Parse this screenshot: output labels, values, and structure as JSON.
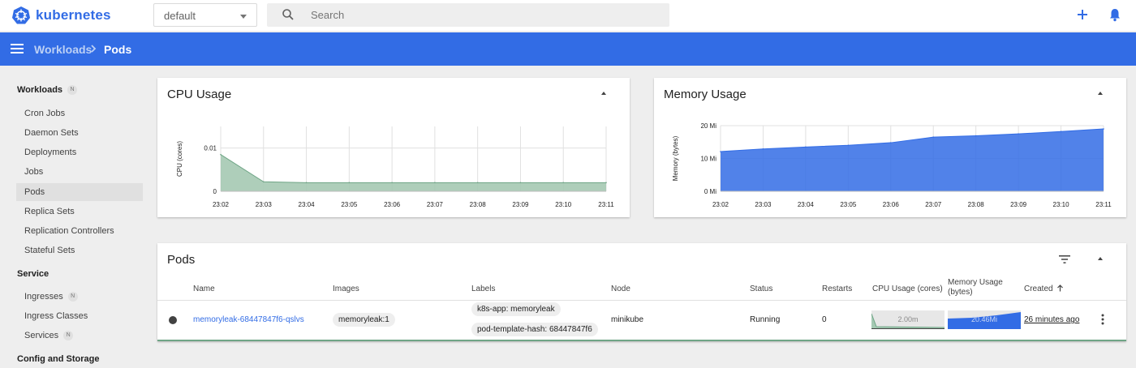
{
  "topbar": {
    "brand": "kubernetes",
    "namespace": "default",
    "search_placeholder": "Search"
  },
  "breadcrumb": {
    "parent": "Workloads",
    "current": "Pods"
  },
  "sidebar": {
    "workloads_label": "Workloads",
    "workloads_badge": "N",
    "workloads_items": [
      {
        "label": "Cron Jobs"
      },
      {
        "label": "Daemon Sets"
      },
      {
        "label": "Deployments"
      },
      {
        "label": "Jobs"
      },
      {
        "label": "Pods"
      },
      {
        "label": "Replica Sets"
      },
      {
        "label": "Replication Controllers"
      },
      {
        "label": "Stateful Sets"
      }
    ],
    "service_label": "Service",
    "service_items": [
      {
        "label": "Ingresses",
        "badge": "N"
      },
      {
        "label": "Ingress Classes"
      },
      {
        "label": "Services",
        "badge": "N"
      }
    ],
    "config_label": "Config and Storage"
  },
  "cpu_card": {
    "title": "CPU Usage",
    "ylabel": "CPU (cores)"
  },
  "memory_card": {
    "title": "Memory Usage",
    "ylabel": "Memory (bytes)"
  },
  "pods_card": {
    "title": "Pods",
    "columns": {
      "name": "Name",
      "images": "Images",
      "labels": "Labels",
      "node": "Node",
      "status": "Status",
      "restarts": "Restarts",
      "cpu": "CPU Usage (cores)",
      "memory_line1": "Memory Usage",
      "memory_line2": "(bytes)",
      "created": "Created"
    },
    "row": {
      "name": "memoryleak-68447847f6-qslvs",
      "image": "memoryleak:1",
      "label1": "k8s-app: memoryleak",
      "label2": "pod-template-hash: 68447847f6",
      "node": "minikube",
      "status": "Running",
      "restarts": "0",
      "cpu": "2.00m",
      "memory": "20.46Mi",
      "created": "26 minutes ago"
    }
  },
  "colors": {
    "brand": "#326ce5",
    "cpu_fill": "#a5c9b3",
    "cpu_stroke": "#6fa586",
    "mem_fill": "#326ce5"
  },
  "chart_data": [
    {
      "type": "area",
      "title": "CPU Usage",
      "ylabel": "CPU (cores)",
      "x": [
        "23:02",
        "23:03",
        "23:04",
        "23:05",
        "23:06",
        "23:07",
        "23:08",
        "23:09",
        "23:10",
        "23:11"
      ],
      "yticks": [
        "0.01",
        "0"
      ],
      "ylim": [
        0,
        0.015
      ],
      "series": [
        {
          "values": [
            0.0085,
            0.0022,
            0.002,
            0.002,
            0.002,
            0.002,
            0.002,
            0.002,
            0.002,
            0.002
          ]
        }
      ],
      "grid": true
    },
    {
      "type": "area",
      "title": "Memory Usage",
      "ylabel": "Memory (bytes)",
      "x": [
        "23:02",
        "23:03",
        "23:04",
        "23:05",
        "23:06",
        "23:07",
        "23:08",
        "23:09",
        "23:10",
        "23:11"
      ],
      "yticks": [
        "20 Mi",
        "10 Mi",
        "0 Mi"
      ],
      "ylim": [
        0,
        20
      ],
      "series": [
        {
          "values": [
            12.1,
            12.9,
            13.5,
            14.0,
            14.8,
            16.5,
            16.9,
            17.5,
            18.2,
            19.0
          ]
        }
      ],
      "grid": true
    }
  ]
}
